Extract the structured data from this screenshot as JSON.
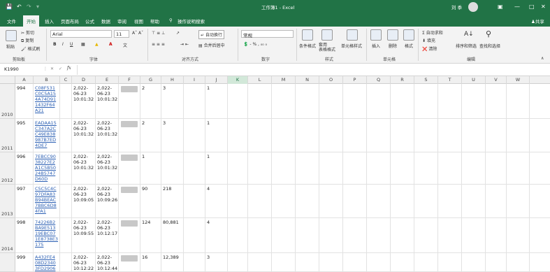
{
  "titlebar": {
    "doc_title": "工作簿1 - Excel",
    "user": "刘 季"
  },
  "menu": {
    "items": [
      "文件",
      "开始",
      "插入",
      "页面布局",
      "公式",
      "数据",
      "审阅",
      "视图",
      "帮助",
      "操作说明搜索"
    ],
    "share": "共享"
  },
  "ribbon": {
    "clipboard": {
      "paste": "粘贴",
      "cut": "剪切",
      "copy": "复制",
      "painter": "格式刷",
      "label": "剪贴板"
    },
    "font": {
      "name": "Arial",
      "size": "11",
      "label": "字体"
    },
    "align": {
      "wrap": "自动换行",
      "merge": "合并后居中",
      "label": "对齐方式"
    },
    "number": {
      "format": "常规",
      "label": "数字"
    },
    "styles": {
      "cond": "条件格式",
      "table": "套用\n表格格式",
      "cell": "单元格样式",
      "label": "样式"
    },
    "cells": {
      "insert": "插入",
      "delete": "删除",
      "format": "格式",
      "label": "单元格"
    },
    "editing": {
      "autosum": "自动求和",
      "fill": "填充",
      "clear": "清除",
      "sort": "排序和筛选",
      "find": "查找和选择",
      "label": "编辑"
    }
  },
  "formula_bar": {
    "name_box": "K1990",
    "fx": "fx",
    "value": ""
  },
  "columns": [
    "A",
    "B",
    "C",
    "D",
    "E",
    "F",
    "G",
    "H",
    "I",
    "J",
    "K",
    "L",
    "M",
    "N",
    "O",
    "P",
    "Q",
    "R",
    "S",
    "T",
    "U",
    "V",
    "W"
  ],
  "selected_column": "K",
  "rows": [
    {
      "num": "2010",
      "a": "994",
      "b": "C08F531\nC0C5A15\n4A74D91\n1432F64\nA21",
      "d": "2,022-\n06-23\n10:01:32",
      "e": "2,022-\n06-23\n10:01:32",
      "g": "2",
      "h": "3",
      "j": "1"
    },
    {
      "num": "2011",
      "a": "995",
      "b": "EADAA15\nC347A2C\nC49E838\n987B7ED\n4DE7",
      "d": "2,022-\n06-23\n10:01:32",
      "e": "2,022-\n06-23\n10:01:32",
      "g": "2",
      "h": "3",
      "j": "1"
    },
    {
      "num": "2012",
      "a": "996",
      "b": "7EBCC90\n38227E2\nA1C5B50\n24B5747\nD60D",
      "d": "2,022-\n06-23\n10:01:32",
      "e": "2,022-\n06-23\n10:01:32",
      "g": "1",
      "h": "",
      "j": "1"
    },
    {
      "num": "2013",
      "a": "997",
      "b": "C5C5C4C\n97DFA83\nB94BEAC\n7BBC6D8\n4FA1",
      "d": "2,022-\n06-23\n10:09:05",
      "e": "2,022-\n06-23\n10:09:26",
      "g": "90",
      "h": "218",
      "j": "4"
    },
    {
      "num": "2014",
      "a": "998",
      "b": "74226B2\nBA9E513\n19EBC07\n1E8738E3\n175",
      "d": "2,022-\n06-23\n10:09:55",
      "e": "2,022-\n06-23\n10:12:17",
      "g": "124",
      "h": "80,881",
      "j": "4"
    },
    {
      "num": "",
      "a": "999",
      "b": "A432FE4\n08D2340\n3FD2906",
      "d": "2,022-\n06-23\n10:12:22",
      "e": "2,022-\n06-23\n10:12:44",
      "g": "16",
      "h": "12,389",
      "j": "3"
    }
  ]
}
